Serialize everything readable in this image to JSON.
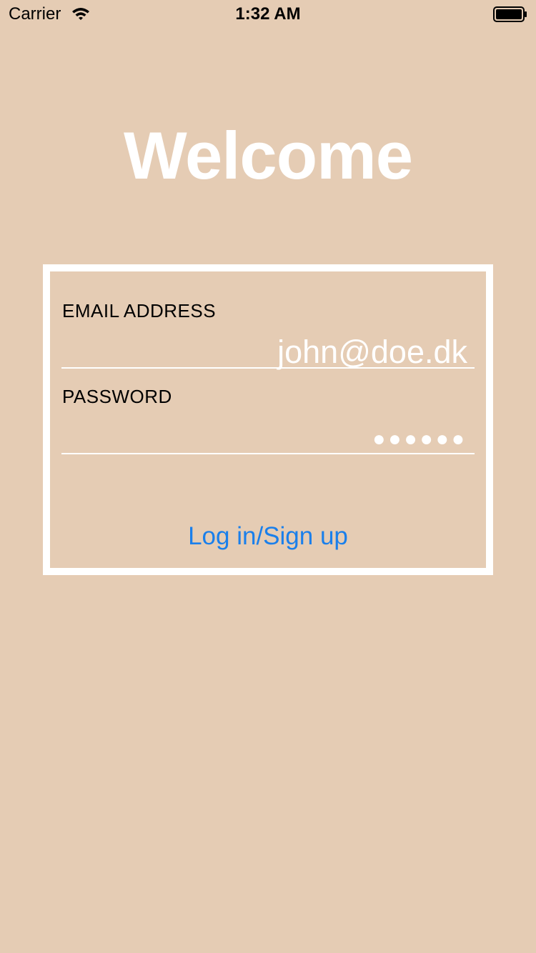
{
  "status_bar": {
    "carrier": "Carrier",
    "time": "1:32 AM",
    "wifi_icon": "wifi-icon",
    "battery_icon": "battery-full-icon"
  },
  "screen": {
    "title": "Welcome",
    "background_color": "#E5CCB4"
  },
  "login_form": {
    "email_label": "EMAIL ADDRESS",
    "email_value": "john@doe.dk",
    "password_label": "PASSWORD",
    "password_value": "●●●●●●",
    "submit_label": "Log in/Sign up",
    "accent_color": "#1A7FEB"
  }
}
